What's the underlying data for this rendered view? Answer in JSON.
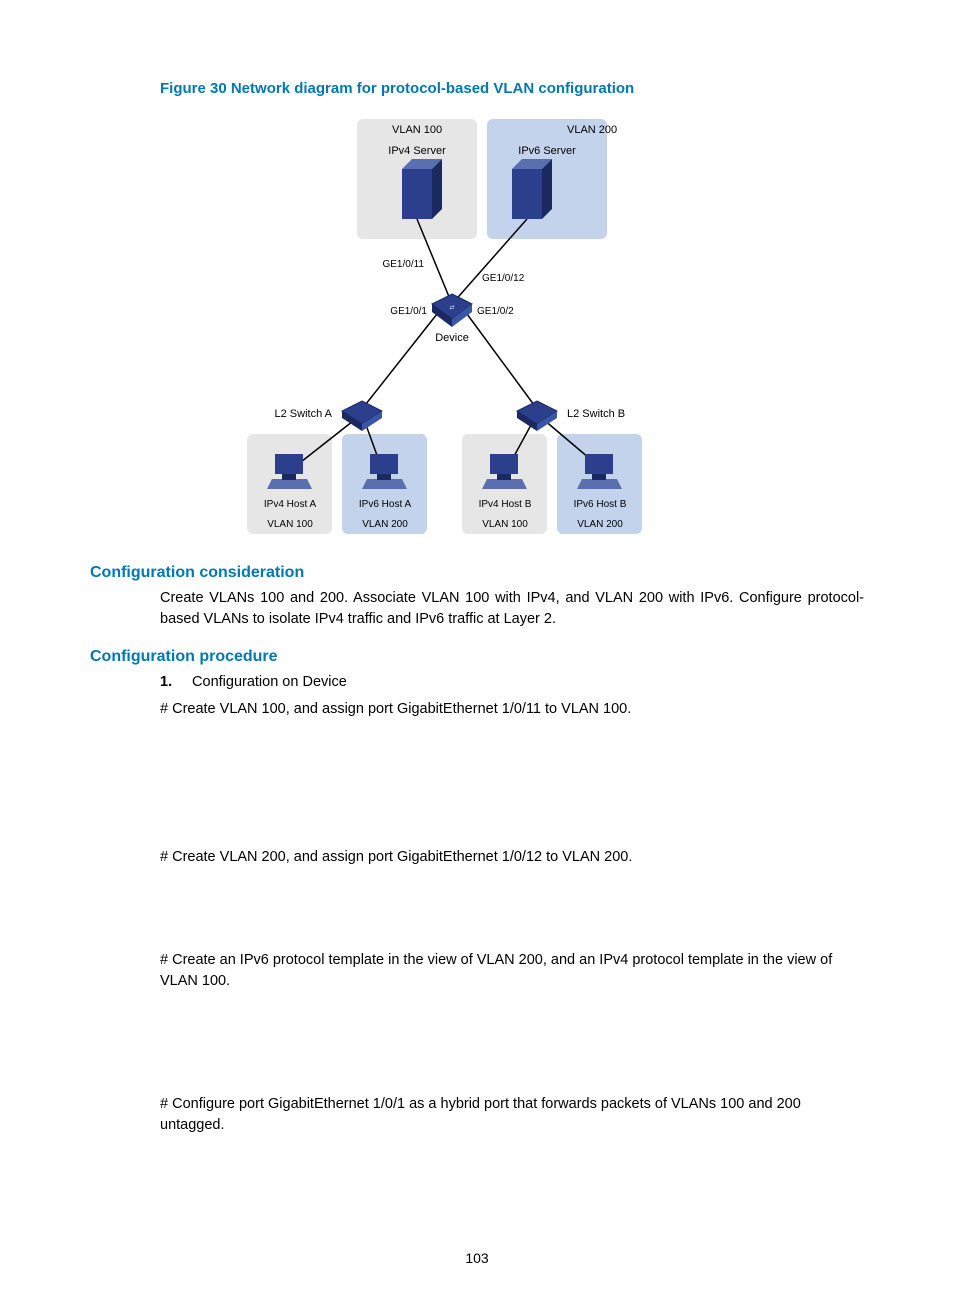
{
  "figure": {
    "caption": "Figure 30 Network diagram for protocol-based VLAN configuration",
    "labels": {
      "vlan100_top": "VLAN 100",
      "vlan200_top": "VLAN 200",
      "ipv4_server": "IPv4 Server",
      "ipv6_server": "IPv6 Server",
      "ge1_0_11": "GE1/0/11",
      "ge1_0_12": "GE1/0/12",
      "ge1_0_1": "GE1/0/1",
      "ge1_0_2": "GE1/0/2",
      "device": "Device",
      "l2_switch_a": "L2 Switch A",
      "l2_switch_b": "L2 Switch B",
      "ipv4_host_a": "IPv4 Host A",
      "ipv6_host_a": "IPv6 Host A",
      "ipv4_host_b": "IPv4 Host B",
      "ipv6_host_b": "IPv6 Host B",
      "vlan100_a": "VLAN 100",
      "vlan200_a": "VLAN 200",
      "vlan100_b": "VLAN 100",
      "vlan200_b": "VLAN 200"
    }
  },
  "headings": {
    "consideration": "Configuration consideration",
    "procedure": "Configuration procedure"
  },
  "text": {
    "consideration_body": "Create VLANs 100 and 200. Associate VLAN 100 with IPv4, and VLAN 200 with IPv6. Configure protocol-based VLANs to isolate IPv4 traffic and IPv6 traffic at Layer 2.",
    "step1_num": "1.",
    "step1_label": "Configuration on Device",
    "hash1": "# Create VLAN 100, and assign port GigabitEthernet 1/0/11 to VLAN 100.",
    "hash2": "# Create VLAN 200, and assign port GigabitEthernet 1/0/12 to VLAN 200.",
    "hash3": "# Create an IPv6 protocol template in the view of VLAN 200, and an IPv4 protocol template in the view of VLAN 100.",
    "hash4": "# Configure port GigabitEthernet 1/0/1 as a hybrid port that forwards packets of VLANs 100 and 200 untagged."
  },
  "pagenum": "103"
}
